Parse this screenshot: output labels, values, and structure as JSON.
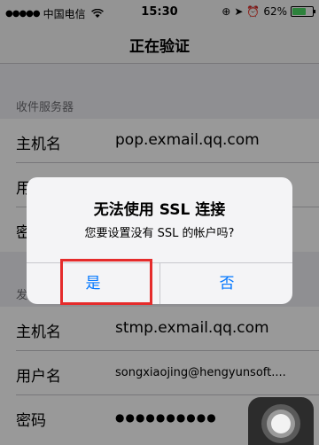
{
  "status": {
    "carrier": "中国电信",
    "time": "15:30",
    "battery": "62%",
    "signal_dots": "●●●●●"
  },
  "nav": {
    "title": "正在验证"
  },
  "incoming": {
    "header": "收件服务器",
    "hostname_label": "主机名",
    "hostname_value": "pop.exmail.qq.com",
    "username_label": "用户名",
    "password_label": "密码"
  },
  "outgoing": {
    "header": "发",
    "hostname_label": "主机名",
    "hostname_value": "stmp.exmail.qq.com",
    "username_label": "用户名",
    "username_value": "songxiaojing@hengyunsoft....",
    "password_label": "密码",
    "password_value": "●●●●●●●●●●"
  },
  "alert": {
    "title": "无法使用 SSL 连接",
    "message": "您要设置没有 SSL 的帐户吗?",
    "yes_label": "是",
    "no_label": "否"
  },
  "colors": {
    "accent": "#0076ff",
    "highlight": "#e52b2b",
    "battery": "#4cd964"
  }
}
